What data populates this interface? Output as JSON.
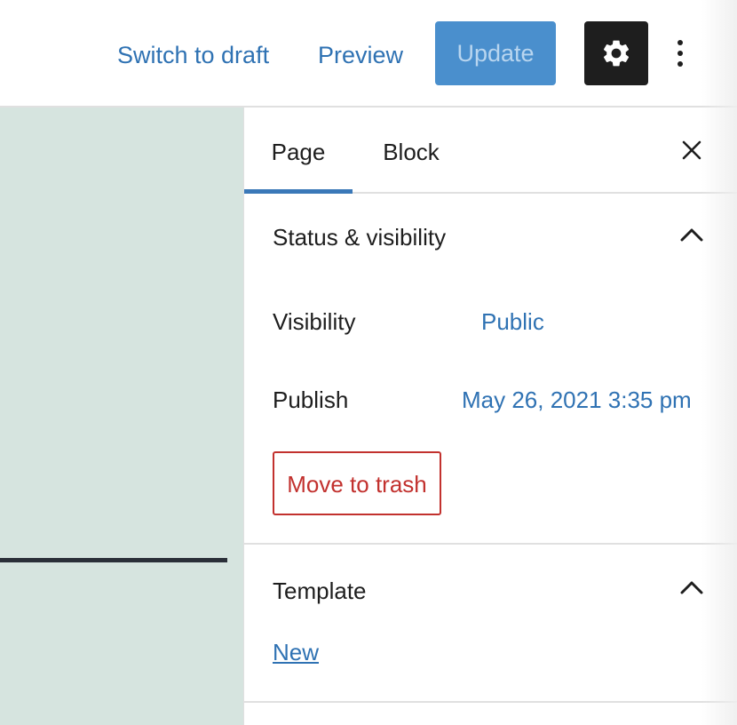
{
  "toolbar": {
    "switch_to_draft_label": "Switch to draft",
    "preview_label": "Preview",
    "update_label": "Update",
    "settings_icon": "gear-icon",
    "more_icon": "more-vertical-icon"
  },
  "sidebar": {
    "tabs": [
      {
        "label": "Page",
        "active": true
      },
      {
        "label": "Block",
        "active": false
      }
    ],
    "close_icon": "close-icon",
    "status_panel": {
      "title": "Status & visibility",
      "expanded": true,
      "visibility_label": "Visibility",
      "visibility_value": "Public",
      "publish_label": "Publish",
      "publish_value": "May 26, 2021 3:35 pm",
      "trash_label": "Move to trash"
    },
    "template_panel": {
      "title": "Template",
      "expanded": true,
      "link_label": "New"
    }
  },
  "colors": {
    "accent": "#2f72b3",
    "update_button": "#4a8fcd",
    "settings_button": "#1e1e1e",
    "canvas_background": "#d6e4df",
    "trash": "#c2312e"
  }
}
